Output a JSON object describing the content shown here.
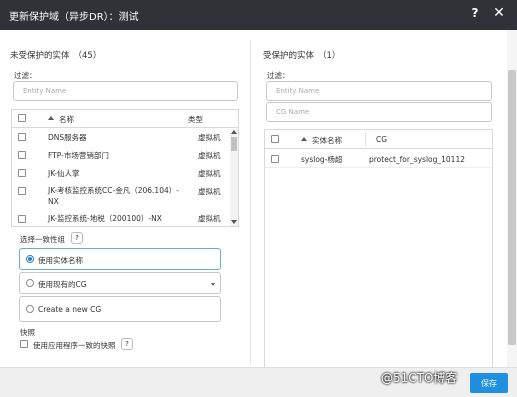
{
  "dialog": {
    "title": "更新保护域（异步DR）：测试",
    "help_label": "?",
    "close_label": "✕"
  },
  "left": {
    "heading": "未受保护的实体",
    "count": "（45）",
    "filter_label": "过滤：",
    "filter_placeholder": "Entity Name",
    "columns": {
      "name": "名称",
      "type": "类型"
    },
    "rows": [
      {
        "name": "DNS服务器",
        "type": "虚拟机"
      },
      {
        "name": "FTP-市场营销部门",
        "type": "虚拟机"
      },
      {
        "name": "JK-仙人掌",
        "type": "虚拟机"
      },
      {
        "name": "JK-考核监控系统CC-金凡（206.104）-",
        "name2": "NX",
        "type": "虚拟机"
      },
      {
        "name": "JK-监控系统-地税（200100）-NX",
        "type": "虚拟机"
      }
    ],
    "cg_label": "选择一致性组",
    "cg_help": "?",
    "options": [
      {
        "label": "使用实体名称"
      },
      {
        "label": "使用现有的CG"
      },
      {
        "label": "Create a new CG"
      }
    ],
    "snapshot_label": "快照",
    "snapshot_checkbox_label": "使用应用程序一致的快照",
    "snapshot_help": "?"
  },
  "right": {
    "heading": "受保护的实体",
    "count": "（1）",
    "filter_label": "过滤：",
    "filter_placeholder_1": "Entity Name",
    "filter_placeholder_2": "CG Name",
    "columns": {
      "name": "实体名称",
      "cg": "CG"
    },
    "rows": [
      {
        "name": "syslog-杨超",
        "cg": "protect_for_syslog_10112"
      }
    ]
  },
  "footer": {
    "confirm_label": "保存"
  },
  "watermark": "@51CTO博客",
  "colors": {
    "titlebar": "#2f3338",
    "accent": "#1f8fe0",
    "radio_selected": "#2a80c8"
  }
}
